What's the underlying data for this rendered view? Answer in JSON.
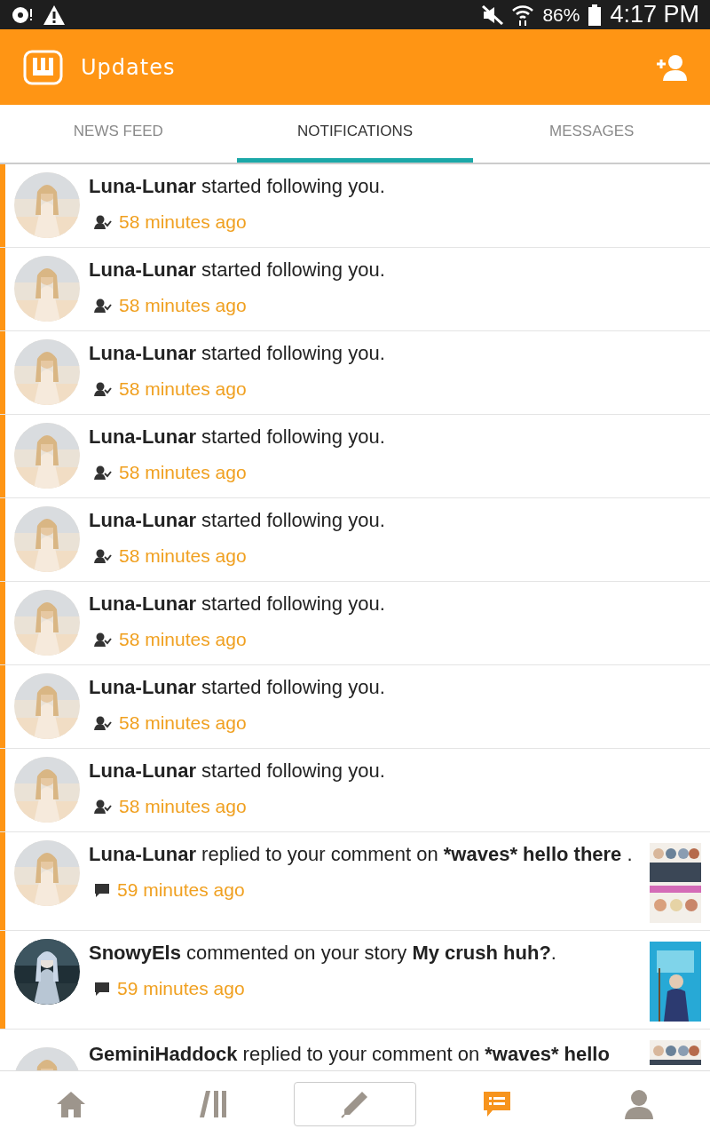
{
  "status_bar": {
    "battery": "86%",
    "time": "4:17 PM"
  },
  "header": {
    "title": "Updates"
  },
  "tabs": [
    {
      "label": "NEWS FEED",
      "selected": false
    },
    {
      "label": "NOTIFICATIONS",
      "selected": true
    },
    {
      "label": "MESSAGES",
      "selected": false
    }
  ],
  "notifications": [
    {
      "kind": "follow",
      "unread": true,
      "text": [
        {
          "text": "Luna-Lunar",
          "bold": true
        },
        {
          "text": " started following you.",
          "bold": false
        }
      ],
      "time": "58 minutes ago",
      "avatar": {
        "kind": "picture"
      }
    },
    {
      "kind": "follow",
      "unread": true,
      "text": [
        {
          "text": "Luna-Lunar",
          "bold": true
        },
        {
          "text": " started following you.",
          "bold": false
        }
      ],
      "time": "58 minutes ago",
      "avatar": {
        "kind": "picture"
      }
    },
    {
      "kind": "follow",
      "unread": true,
      "text": [
        {
          "text": "Luna-Lunar",
          "bold": true
        },
        {
          "text": " started following you.",
          "bold": false
        }
      ],
      "time": "58 minutes ago",
      "avatar": {
        "kind": "picture"
      }
    },
    {
      "kind": "follow",
      "unread": true,
      "text": [
        {
          "text": "Luna-Lunar",
          "bold": true
        },
        {
          "text": " started following you.",
          "bold": false
        }
      ],
      "time": "58 minutes ago",
      "avatar": {
        "kind": "picture"
      }
    },
    {
      "kind": "follow",
      "unread": true,
      "text": [
        {
          "text": "Luna-Lunar",
          "bold": true
        },
        {
          "text": " started following you.",
          "bold": false
        }
      ],
      "time": "58 minutes ago",
      "avatar": {
        "kind": "picture"
      }
    },
    {
      "kind": "follow",
      "unread": true,
      "text": [
        {
          "text": "Luna-Lunar",
          "bold": true
        },
        {
          "text": " started following you.",
          "bold": false
        }
      ],
      "time": "58 minutes ago",
      "avatar": {
        "kind": "picture"
      }
    },
    {
      "kind": "follow",
      "unread": true,
      "text": [
        {
          "text": "Luna-Lunar",
          "bold": true
        },
        {
          "text": " started following you.",
          "bold": false
        }
      ],
      "time": "58 minutes ago",
      "avatar": {
        "kind": "picture"
      }
    },
    {
      "kind": "follow",
      "unread": true,
      "text": [
        {
          "text": "Luna-Lunar",
          "bold": true
        },
        {
          "text": " started following you.",
          "bold": false
        }
      ],
      "time": "58 minutes ago",
      "avatar": {
        "kind": "picture"
      }
    },
    {
      "kind": "comment",
      "unread": true,
      "text": [
        {
          "text": "Luna-Lunar",
          "bold": true
        },
        {
          "text": " replied to your comment on ",
          "bold": false
        },
        {
          "text": "*waves* hello there",
          "bold": true
        },
        {
          "text": " .",
          "bold": false
        }
      ],
      "time": "59 minutes ago",
      "avatar": {
        "kind": "picture"
      },
      "thumbnail": {
        "kind": "picture"
      }
    },
    {
      "kind": "comment",
      "unread": true,
      "text": [
        {
          "text": "SnowyEls",
          "bold": true
        },
        {
          "text": " commented on your story ",
          "bold": false
        },
        {
          "text": "My crush huh?",
          "bold": true
        },
        {
          "text": ".",
          "bold": false
        }
      ],
      "time": "59 minutes ago",
      "avatar": {
        "kind": "picture"
      },
      "thumbnail": {
        "kind": "picture"
      }
    },
    {
      "unread": false,
      "text": [
        {
          "text": "GeminiHaddock",
          "bold": true
        },
        {
          "text": " replied to your comment on ",
          "bold": false
        },
        {
          "text": "*waves* hello",
          "bold": true
        }
      ],
      "avatar": {
        "kind": "picture"
      },
      "thumbnail": {
        "kind": "picture"
      }
    }
  ],
  "bottom_nav": [
    {
      "selected": false
    },
    {
      "selected": false
    },
    {
      "selected": false
    },
    {
      "selected": true
    },
    {
      "selected": false
    }
  ]
}
